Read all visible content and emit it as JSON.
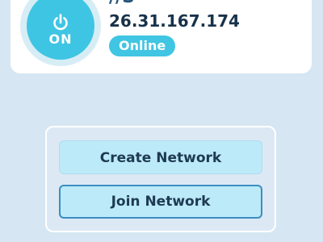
{
  "status": {
    "power_label": "ON",
    "host_name": "//S",
    "ip_address": "26.31.167.174",
    "status_badge": "Online"
  },
  "actions": {
    "create_network": "Create Network",
    "join_network": "Join Network"
  },
  "colors": {
    "accent": "#40c5e3",
    "background": "#d6e6f2",
    "focus_border": "#3a8ec2"
  },
  "icons": {
    "power": "power-icon"
  }
}
